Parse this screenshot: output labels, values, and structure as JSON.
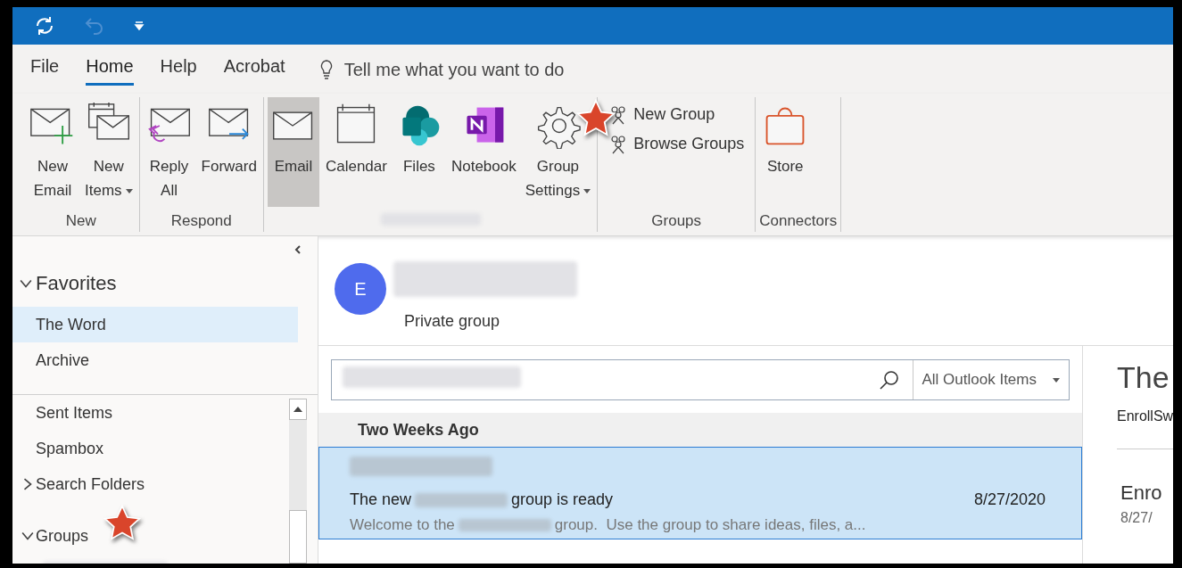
{
  "menu_tabs": [
    {
      "label": "File",
      "selected": false
    },
    {
      "label": "Home",
      "selected": true
    },
    {
      "label": "Help",
      "selected": false
    },
    {
      "label": "Acrobat",
      "selected": false
    }
  ],
  "tell_me": {
    "placeholder": "Tell me what you want to do"
  },
  "ribbon_groups": [
    {
      "label": "New",
      "buttons": [
        {
          "kind": "new-email",
          "lines": [
            "New",
            "Email"
          ],
          "dropdown": false,
          "selected": false
        },
        {
          "kind": "new-items",
          "lines": [
            "New",
            "Items"
          ],
          "dropdown": true,
          "selected": false
        }
      ]
    },
    {
      "label": "Respond",
      "buttons": [
        {
          "kind": "reply-all",
          "lines": [
            "Reply",
            "All"
          ],
          "dropdown": false,
          "selected": false
        },
        {
          "kind": "forward",
          "lines": [
            "Forward"
          ],
          "dropdown": false,
          "selected": false
        }
      ]
    },
    {
      "redacted_label": true,
      "buttons": [
        {
          "kind": "email",
          "lines": [
            "Email"
          ],
          "dropdown": false,
          "selected": true
        },
        {
          "kind": "calendar",
          "lines": [
            "Calendar"
          ],
          "dropdown": false,
          "selected": false
        },
        {
          "kind": "files",
          "lines": [
            "Files"
          ],
          "dropdown": false,
          "selected": false
        },
        {
          "kind": "notebook",
          "lines": [
            "Notebook"
          ],
          "dropdown": false,
          "selected": false
        },
        {
          "kind": "settings",
          "lines": [
            "Group",
            "Settings"
          ],
          "dropdown": true,
          "selected": false,
          "starred": true
        }
      ]
    },
    {
      "label": "Groups",
      "small_buttons": [
        "New Group",
        "Browse Groups"
      ]
    },
    {
      "label": "Connectors",
      "buttons": [
        {
          "kind": "store",
          "lines": [
            "Store"
          ],
          "dropdown": false,
          "selected": false
        }
      ]
    }
  ],
  "folder_pane": {
    "favorites": {
      "label": "Favorites",
      "expanded": true,
      "items": [
        {
          "label": "The Word",
          "selected": true
        },
        {
          "label": "Archive",
          "selected": false
        }
      ]
    },
    "folders": [
      {
        "label": "Sent Items",
        "kind": "folder"
      },
      {
        "label": "Spambox",
        "kind": "folder"
      },
      {
        "label": "Search Folders",
        "kind": "collapsed"
      },
      {
        "label": "Groups",
        "kind": "expanded",
        "starred": true
      }
    ]
  },
  "group_header": {
    "initial": "E",
    "subtitle": "Private group"
  },
  "search": {
    "scope": "All Outlook Items"
  },
  "message_list": {
    "section": "Two Weeks Ago",
    "messages": [
      {
        "selected": true,
        "subject_start": "The new",
        "subject_end": "group is ready",
        "date": "8/27/2020",
        "preview_start": "Welcome to the",
        "preview_end": "group.  Use the group to share ideas, files, a..."
      }
    ]
  },
  "reading_pane": {
    "title": "The",
    "sender": "EnrollSw",
    "item_title": "Enro",
    "item_date": "8/27/"
  }
}
